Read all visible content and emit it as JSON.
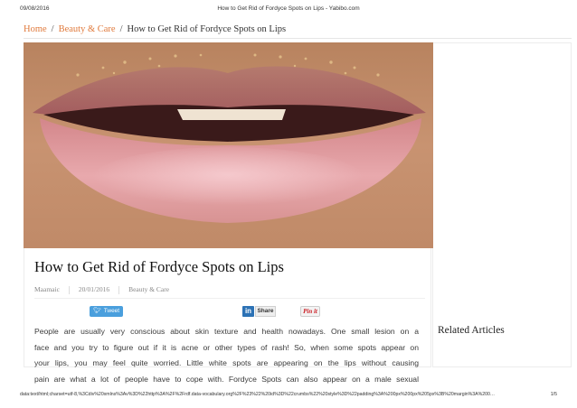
{
  "print_header": {
    "date": "09/08/2016",
    "title": "How to Get Rid of Fordyce Spots on Lips - Yabibo.com"
  },
  "breadcrumb": {
    "home": "Home",
    "sep1": "/",
    "category": "Beauty & Care",
    "sep2": "/",
    "current": "How to Get Rid of Fordyce Spots on Lips"
  },
  "article": {
    "title": "How to Get Rid of Fordyce Spots on Lips",
    "meta": {
      "author": "Maamaic",
      "date": "20/01/2016",
      "category": "Beauty & Care"
    },
    "share": {
      "tweet": "Tweet",
      "linkedin_logo": "in",
      "linkedin_share": "Share",
      "pin": "Pin it"
    },
    "body_lines": [
      "People are usually very conscious about skin texture and health nowadays. One small lesion on a",
      "face and you try to figure out if it is acne or other types of rash! So, when some spots appear on",
      "your lips, you may feel quite worried. Little white spots are appearing on the lips without causing",
      "pain are what a lot of people have to cope with. Fordyce Spots can also appear on a male sexual"
    ]
  },
  "sidebar": {
    "heading": "Related Articles"
  },
  "print_footer": {
    "url": "data:text/html;charset=utf-8,%3Cdiv%20xmlns%3Av%3D%22http%3A%2F%2Frdf.data-vocabulary.org%2F%23%22%20id%3D%22crumbs%22%20style%3D%22padding%3A%200px%200px%205px%3B%20margin%3A%200…",
    "page": "1/5"
  },
  "colors": {
    "link": "#e07a3c",
    "tweet": "#4a9fdd",
    "linkedin": "#2c72b5",
    "pinterest": "#cb2027"
  },
  "icons": [
    "twitter-bird-icon",
    "linkedin-icon",
    "pinterest-icon"
  ]
}
